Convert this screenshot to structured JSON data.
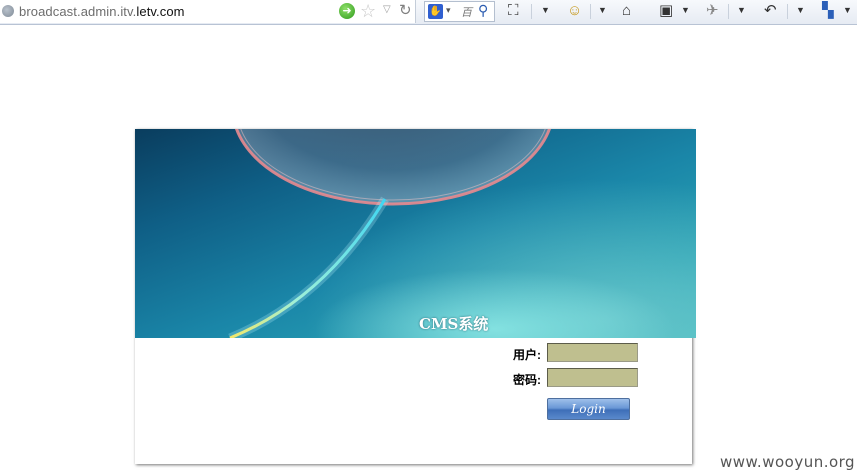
{
  "browser": {
    "url_prefix": "broadcast.admin.itv.",
    "url_domain": "letv.com",
    "search_engine_label": "百",
    "buttons": [
      "go",
      "bookmark-star",
      "history-dropdown",
      "reload",
      "search",
      "web-slice",
      "feeds",
      "home",
      "favorites",
      "tools",
      "share",
      "apps"
    ]
  },
  "banner": {
    "title": "CMS系统"
  },
  "form": {
    "username_label": "用户:",
    "password_label": "密码:",
    "username_value": "",
    "password_value": "",
    "login_label": "Login"
  },
  "watermark": "www.wooyun.org",
  "colors": {
    "input_bg": "#bfbf8f",
    "button_blue": "#4f7fc4",
    "banner_dark": "#0a3d5e",
    "banner_light": "#46bcc0"
  }
}
